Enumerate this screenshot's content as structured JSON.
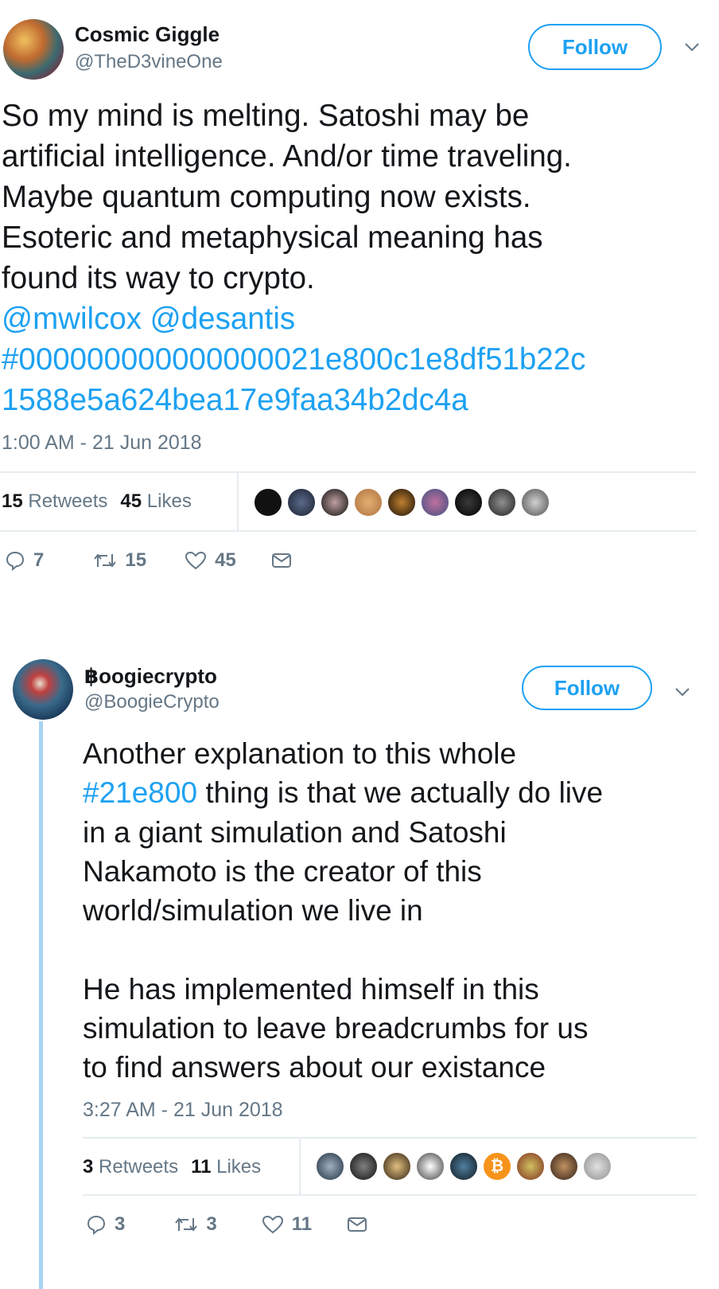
{
  "tweets": [
    {
      "name": "Cosmic Giggle",
      "handle": "@TheD3vineOne",
      "follow_label": "Follow",
      "text_lines": [
        "So my mind is melting. Satoshi may be",
        "artificial intelligence. And/or time traveling.",
        "Maybe quantum computing now exists.",
        "Esoteric and metaphysical meaning has",
        "found its way to crypto."
      ],
      "mentions": "@mwilcox @desantis",
      "hashtag_line1": "#000000000000000021e800c1e8df51b22c",
      "hashtag_line2": "1588e5a624bea17e9faa34b2dc4a",
      "timestamp": "1:00 AM - 21 Jun 2018",
      "retweets_count": "15",
      "retweets_label": "Retweets",
      "likes_count": "45",
      "likes_label": "Likes",
      "reply_count": "7",
      "retweet_count": "15",
      "like_count": "45"
    },
    {
      "name": "฿oogiecrypto",
      "handle": "@BoogieCrypto",
      "follow_label": "Follow",
      "text_line1_pre": "Another explanation to this whole",
      "hashtag": "#21e800",
      "text_line2_post": " thing is that we actually do live",
      "text_lines_rest": [
        "in a giant simulation and Satoshi",
        "Nakamoto is the creator of this",
        "world/simulation we live in",
        "",
        "He has implemented himself in this",
        "simulation to leave breadcrumbs for us",
        "to find answers about our existance"
      ],
      "timestamp": "3:27 AM - 21 Jun 2018",
      "retweets_count": "3",
      "retweets_label": "Retweets",
      "likes_count": "11",
      "likes_label": "Likes",
      "reply_count": "3",
      "retweet_count": "3",
      "like_count": "11"
    }
  ],
  "colors": {
    "accent": "#1da1f2",
    "muted": "#657786",
    "thread_line": "#a8d4f3"
  },
  "icons": [
    "reply-icon",
    "retweet-icon",
    "heart-icon",
    "message-icon",
    "chevron-down-icon"
  ]
}
